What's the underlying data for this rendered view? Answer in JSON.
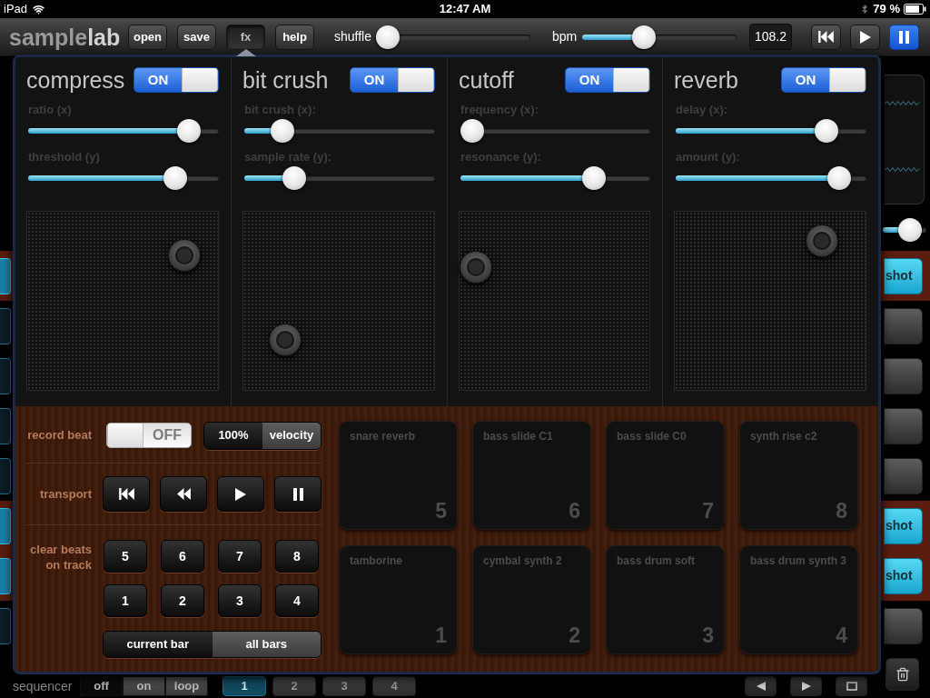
{
  "status_bar": {
    "device": "iPad",
    "time": "12:47 AM",
    "battery": "79 %"
  },
  "toolbar": {
    "logo": {
      "prefix": "sample",
      "suffix": "lab"
    },
    "buttons": [
      {
        "label": "open",
        "selected": false
      },
      {
        "label": "save",
        "selected": false
      },
      {
        "label": "fx",
        "selected": true
      },
      {
        "label": "help",
        "selected": false
      }
    ],
    "sliders": [
      {
        "label": "shuffle",
        "level": 0
      },
      {
        "label": "bpm",
        "level": 0.38
      }
    ],
    "bpm_reading": "108.2",
    "transport": [
      {
        "kind": "skip-back",
        "selected": false
      },
      {
        "kind": "play",
        "selected": false
      },
      {
        "kind": "pause",
        "selected": true
      }
    ]
  },
  "fx_popover": {
    "effects": [
      {
        "title": "compress",
        "on": true,
        "switch_label": "ON",
        "sliders": [
          {
            "label": "ratio (x)",
            "level": 0.89
          },
          {
            "label": "threshold (y)",
            "level": 0.81
          }
        ]
      },
      {
        "title": "bit crush",
        "on": true,
        "switch_label": "ON",
        "sliders": [
          {
            "label": "bit crush (x):",
            "level": 0.16
          },
          {
            "label": "sample rate (y):",
            "level": 0.23
          }
        ]
      },
      {
        "title": "cutoff",
        "on": true,
        "switch_label": "ON",
        "sliders": [
          {
            "label": "frequency (x):",
            "level": 0
          },
          {
            "label": "resonance (y):",
            "level": 0.73
          }
        ]
      },
      {
        "title": "reverb",
        "on": true,
        "switch_label": "ON",
        "sliders": [
          {
            "label": "delay (x):",
            "level": 0.83
          },
          {
            "label": "amount (y):",
            "level": 0.91
          }
        ]
      }
    ],
    "record_beat": {
      "label": "record beat",
      "switch": {
        "on": false,
        "label": "OFF"
      },
      "velocity": [
        {
          "label": "100%",
          "selected": true
        },
        {
          "label": "velocity",
          "selected": false
        }
      ]
    },
    "transport": {
      "label": "transport",
      "buttons": [
        {
          "kind": "skip-back"
        },
        {
          "kind": "rewind"
        },
        {
          "kind": "play"
        },
        {
          "kind": "pause"
        }
      ]
    },
    "clear_beats": {
      "label": "clear beats on track",
      "tracks": [
        "5",
        "6",
        "7",
        "8",
        "1",
        "2",
        "3",
        "4"
      ],
      "scope": [
        {
          "label": "current bar",
          "selected": true
        },
        {
          "label": "all bars",
          "selected": false
        }
      ]
    },
    "pads": [
      {
        "name": "snare reverb",
        "number": "5"
      },
      {
        "name": "bass slide C1",
        "number": "6"
      },
      {
        "name": "bass slide C0",
        "number": "7"
      },
      {
        "name": "synth rise c2",
        "number": "8"
      },
      {
        "name": "tamborine",
        "number": "1"
      },
      {
        "name": "cymbal synth 2",
        "number": "2"
      },
      {
        "name": "bass drum soft",
        "number": "3"
      },
      {
        "name": "bass drum synth 3",
        "number": "4"
      }
    ]
  },
  "track_rows": [
    {
      "on": true,
      "mode": "shot"
    },
    {
      "on": false
    },
    {
      "on": false
    },
    {
      "on": false
    },
    {
      "on": false
    },
    {
      "on": true,
      "mode": "shot"
    },
    {
      "on": true,
      "mode": "shot"
    },
    {
      "on": false
    }
  ],
  "track_volume": {
    "level": 0.77
  },
  "sequencer": {
    "label": "sequencer",
    "modes": [
      {
        "label": "off",
        "selected": true
      },
      {
        "label": "on",
        "selected": false
      },
      {
        "label": "loop",
        "selected": false
      }
    ],
    "bars": [
      {
        "label": "1",
        "selected": true
      },
      {
        "label": "2",
        "selected": false
      },
      {
        "label": "3",
        "selected": false
      },
      {
        "label": "4",
        "selected": false
      }
    ]
  }
}
